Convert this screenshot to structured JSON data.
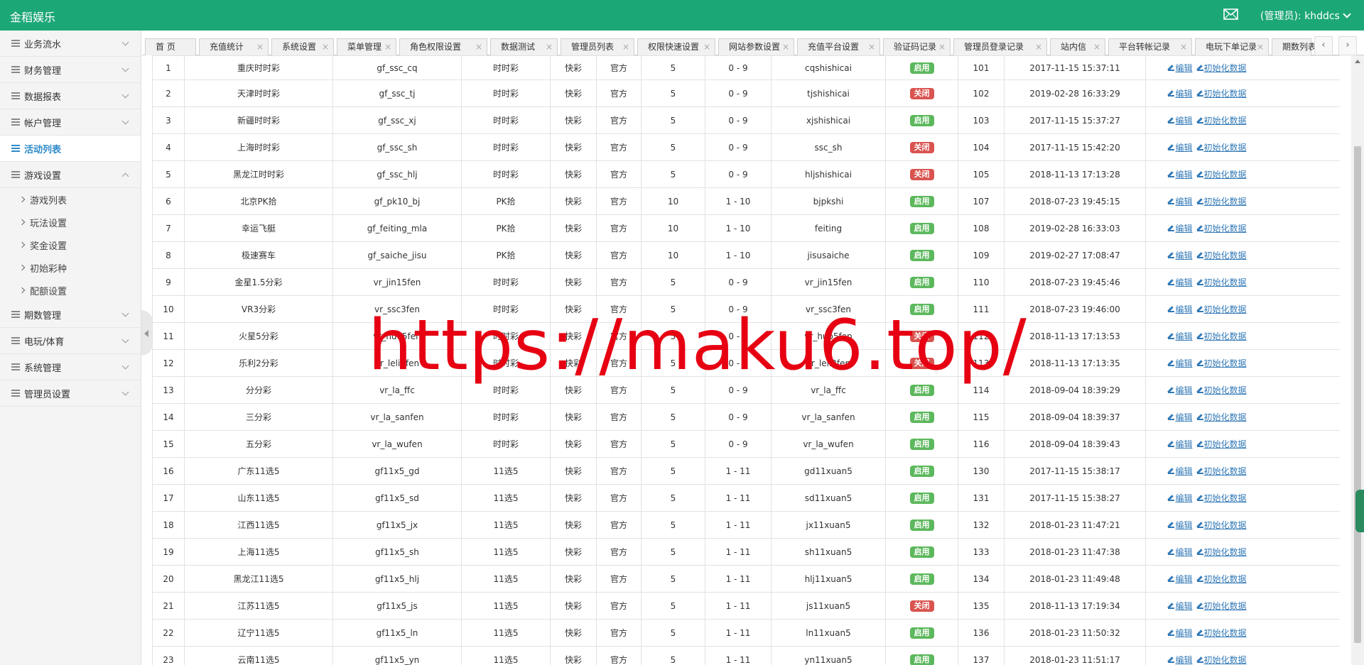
{
  "header": {
    "brand": "金稻娱乐",
    "admin_label": "(管理员): khddcs"
  },
  "sidebar": {
    "items": [
      {
        "label": "业务流水"
      },
      {
        "label": "财务管理"
      },
      {
        "label": "数据报表"
      },
      {
        "label": "帐户管理"
      },
      {
        "label": "活动列表",
        "active": true
      },
      {
        "label": "游戏设置",
        "expanded": true,
        "children": [
          "游戏列表",
          "玩法设置",
          "奖金设置",
          "初始彩种",
          "配额设置"
        ]
      },
      {
        "label": "期数管理"
      },
      {
        "label": "电玩/体育"
      },
      {
        "label": "系统管理"
      },
      {
        "label": "管理员设置"
      }
    ]
  },
  "tabs": [
    "首 页",
    "充值统计",
    "系统设置",
    "菜单管理",
    "角色权限设置",
    "数据测试",
    "管理员列表",
    "权限快速设置",
    "网站参数设置",
    "充值平台设置",
    "验证码记录",
    "管理员登录记录",
    "站内信",
    "平台转帐记录",
    "电玩下单记录",
    "期数列表"
  ],
  "table": {
    "actions": {
      "edit": "编辑",
      "init": "初始化数据"
    },
    "status_labels": {
      "on": "启用",
      "off": "关闭"
    },
    "rows": [
      [
        "1",
        "重庆时时彩",
        "gf_ssc_cq",
        "时时彩",
        "快彩",
        "官方",
        "5",
        "0 - 9",
        "cqshishicai",
        "on",
        "101",
        "2017-11-15 15:37:11"
      ],
      [
        "2",
        "天津时时彩",
        "gf_ssc_tj",
        "时时彩",
        "快彩",
        "官方",
        "5",
        "0 - 9",
        "tjshishicai",
        "off",
        "102",
        "2019-02-28 16:33:29"
      ],
      [
        "3",
        "新疆时时彩",
        "gf_ssc_xj",
        "时时彩",
        "快彩",
        "官方",
        "5",
        "0 - 9",
        "xjshishicai",
        "on",
        "103",
        "2017-11-15 15:37:27"
      ],
      [
        "4",
        "上海时时彩",
        "gf_ssc_sh",
        "时时彩",
        "快彩",
        "官方",
        "5",
        "0 - 9",
        "ssc_sh",
        "off",
        "104",
        "2017-11-15 15:42:20"
      ],
      [
        "5",
        "黑龙江时时彩",
        "gf_ssc_hlj",
        "时时彩",
        "快彩",
        "官方",
        "5",
        "0 - 9",
        "hljshishicai",
        "off",
        "105",
        "2018-11-13 17:13:28"
      ],
      [
        "6",
        "北京PK拾",
        "gf_pk10_bj",
        "PK拾",
        "快彩",
        "官方",
        "10",
        "1 - 10",
        "bjpkshi",
        "on",
        "107",
        "2018-07-23 19:45:15"
      ],
      [
        "7",
        "幸运飞艇",
        "gf_feiting_mla",
        "PK拾",
        "快彩",
        "官方",
        "10",
        "1 - 10",
        "feiting",
        "on",
        "108",
        "2019-02-28 16:33:03"
      ],
      [
        "8",
        "极速赛车",
        "gf_saiche_jisu",
        "PK拾",
        "快彩",
        "官方",
        "10",
        "1 - 10",
        "jisusaiche",
        "on",
        "109",
        "2019-02-27 17:08:47"
      ],
      [
        "9",
        "金星1.5分彩",
        "vr_jin15fen",
        "时时彩",
        "快彩",
        "官方",
        "5",
        "0 - 9",
        "vr_jin15fen",
        "on",
        "110",
        "2018-07-23 19:45:46"
      ],
      [
        "10",
        "VR3分彩",
        "vr_ssc3fen",
        "时时彩",
        "快彩",
        "官方",
        "5",
        "0 - 9",
        "vr_ssc3fen",
        "on",
        "111",
        "2018-07-23 19:46:00"
      ],
      [
        "11",
        "火星5分彩",
        "vr_huo5fen",
        "时时彩",
        "快彩",
        "官方",
        "5",
        "0 - 9",
        "vr_huo5fen",
        "off",
        "112",
        "2018-11-13 17:13:53"
      ],
      [
        "12",
        "乐利2分彩",
        "vr_leli2fen",
        "时时彩",
        "快彩",
        "官方",
        "5",
        "0 - 9",
        "vr_leli2fen",
        "off",
        "113",
        "2018-11-13 17:13:35"
      ],
      [
        "13",
        "分分彩",
        "vr_la_ffc",
        "时时彩",
        "快彩",
        "官方",
        "5",
        "0 - 9",
        "vr_la_ffc",
        "on",
        "114",
        "2018-09-04 18:39:29"
      ],
      [
        "14",
        "三分彩",
        "vr_la_sanfen",
        "时时彩",
        "快彩",
        "官方",
        "5",
        "0 - 9",
        "vr_la_sanfen",
        "on",
        "115",
        "2018-09-04 18:39:37"
      ],
      [
        "15",
        "五分彩",
        "vr_la_wufen",
        "时时彩",
        "快彩",
        "官方",
        "5",
        "0 - 9",
        "vr_la_wufen",
        "on",
        "116",
        "2018-09-04 18:39:43"
      ],
      [
        "16",
        "广东11选5",
        "gf11x5_gd",
        "11选5",
        "快彩",
        "官方",
        "5",
        "1 - 11",
        "gd11xuan5",
        "on",
        "130",
        "2017-11-15 15:38:17"
      ],
      [
        "17",
        "山东11选5",
        "gf11x5_sd",
        "11选5",
        "快彩",
        "官方",
        "5",
        "1 - 11",
        "sd11xuan5",
        "on",
        "131",
        "2017-11-15 15:38:27"
      ],
      [
        "18",
        "江西11选5",
        "gf11x5_jx",
        "11选5",
        "快彩",
        "官方",
        "5",
        "1 - 11",
        "jx11xuan5",
        "on",
        "132",
        "2018-01-23 11:47:21"
      ],
      [
        "19",
        "上海11选5",
        "gf11x5_sh",
        "11选5",
        "快彩",
        "官方",
        "5",
        "1 - 11",
        "sh11xuan5",
        "on",
        "133",
        "2018-01-23 11:47:38"
      ],
      [
        "20",
        "黑龙江11选5",
        "gf11x5_hlj",
        "11选5",
        "快彩",
        "官方",
        "5",
        "1 - 11",
        "hlj11xuan5",
        "on",
        "134",
        "2018-01-23 11:49:48"
      ],
      [
        "21",
        "江苏11选5",
        "gf11x5_js",
        "11选5",
        "快彩",
        "官方",
        "5",
        "1 - 11",
        "js11xuan5",
        "off",
        "135",
        "2018-11-13 17:19:34"
      ],
      [
        "22",
        "辽宁11选5",
        "gf11x5_ln",
        "11选5",
        "快彩",
        "官方",
        "5",
        "1 - 11",
        "ln11xuan5",
        "on",
        "136",
        "2018-01-23 11:50:32"
      ],
      [
        "23",
        "云南11选5",
        "gf11x5_yn",
        "11选5",
        "快彩",
        "官方",
        "5",
        "1 - 11",
        "yn11xuan5",
        "on",
        "137",
        "2018-01-23 11:51:17"
      ]
    ]
  },
  "watermark": "https://maku6.top/"
}
